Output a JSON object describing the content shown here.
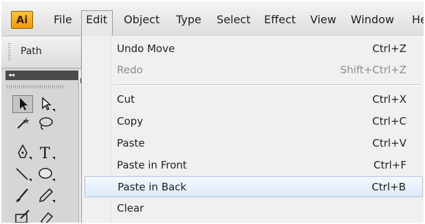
{
  "app": {
    "logo_text": "Ai",
    "accent_color": "#f7a823"
  },
  "menubar": {
    "items": [
      {
        "label": "File"
      },
      {
        "label": "Edit",
        "active": true
      },
      {
        "label": "Object"
      },
      {
        "label": "Type"
      },
      {
        "label": "Select"
      },
      {
        "label": "Effect"
      },
      {
        "label": "View"
      },
      {
        "label": "Window"
      },
      {
        "label": "He"
      }
    ]
  },
  "control_panel": {
    "path_label": "Path"
  },
  "tools_panel": {
    "collapse_glyph": "◂◂",
    "tools": [
      {
        "icon": "selection-tool-icon",
        "selected": true
      },
      {
        "icon": "direct-selection-tool-icon"
      },
      {
        "icon": "magic-wand-tool-icon"
      },
      {
        "icon": "lasso-tool-icon"
      },
      {
        "icon": "pen-tool-icon"
      },
      {
        "icon": "type-tool-icon"
      },
      {
        "icon": "line-segment-tool-icon"
      },
      {
        "icon": "ellipse-tool-icon"
      },
      {
        "icon": "paintbrush-tool-icon"
      },
      {
        "icon": "pencil-tool-icon"
      },
      {
        "icon": "blob-brush-tool-icon"
      },
      {
        "icon": "eraser-tool-icon"
      }
    ]
  },
  "edit_menu": {
    "items": [
      {
        "label": "Undo Move",
        "shortcut": "Ctrl+Z",
        "enabled": true
      },
      {
        "label": "Redo",
        "shortcut": "Shift+Ctrl+Z",
        "enabled": false
      },
      {
        "separator": true
      },
      {
        "label": "Cut",
        "shortcut": "Ctrl+X",
        "enabled": true
      },
      {
        "label": "Copy",
        "shortcut": "Ctrl+C",
        "enabled": true
      },
      {
        "label": "Paste",
        "shortcut": "Ctrl+V",
        "enabled": true
      },
      {
        "label": "Paste in Front",
        "shortcut": "Ctrl+F",
        "enabled": true
      },
      {
        "label": "Paste in Back",
        "shortcut": "Ctrl+B",
        "enabled": true,
        "highlighted": true
      },
      {
        "label": "Clear",
        "shortcut": "",
        "enabled": true
      }
    ]
  },
  "colors": {
    "highlight_border": "#a9c4ea",
    "disabled_text": "#8c8c8c"
  }
}
